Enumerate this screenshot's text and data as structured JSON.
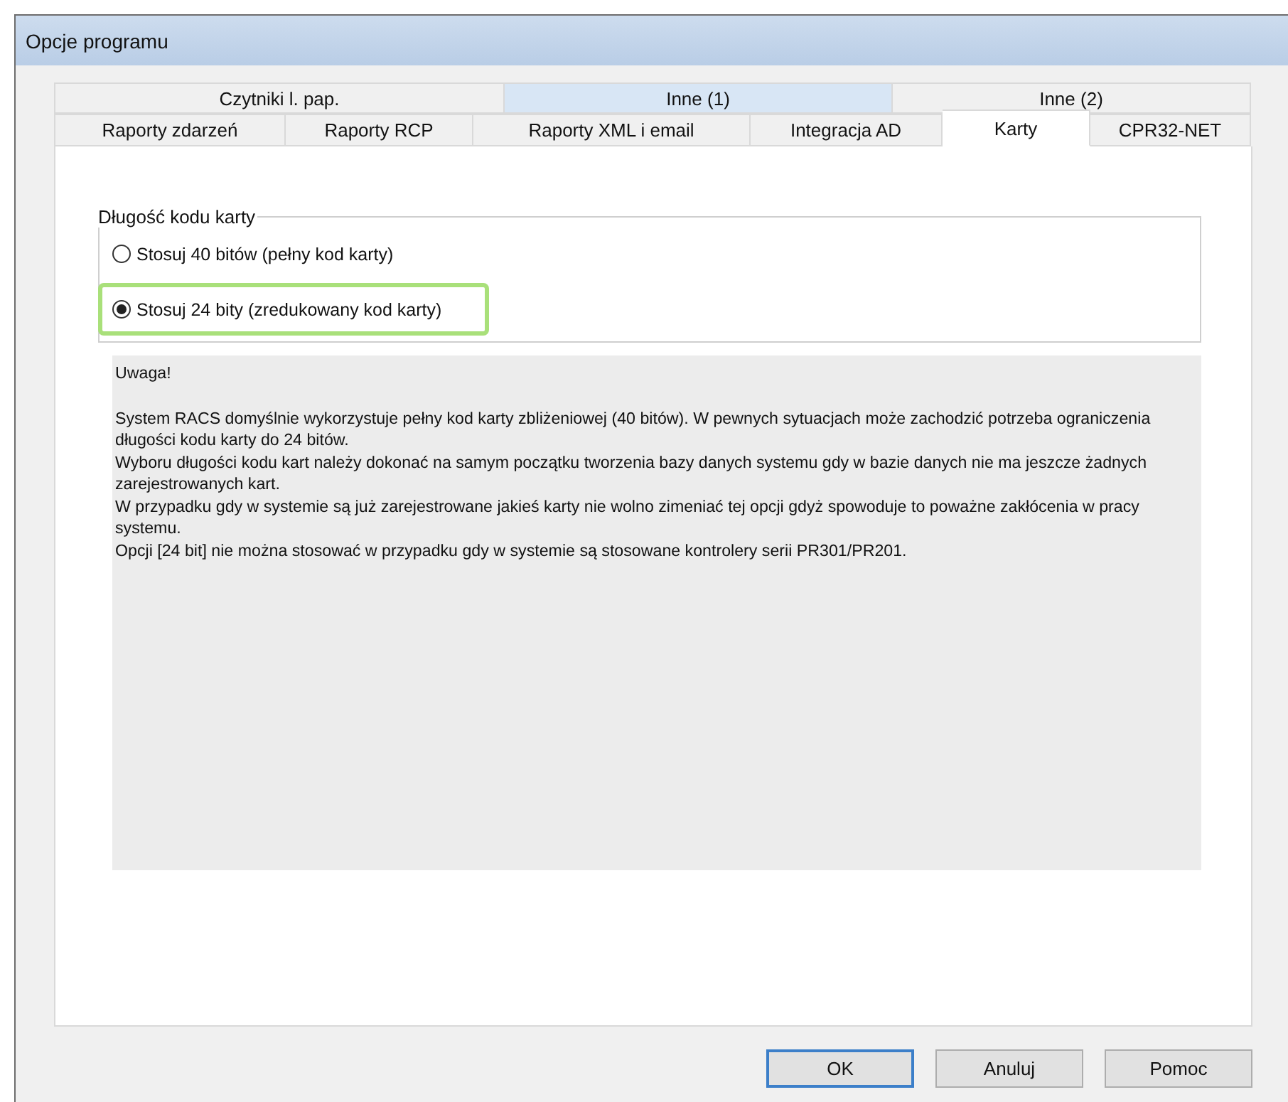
{
  "window": {
    "title": "Opcje programu"
  },
  "tab_rows": [
    [
      {
        "label": "Czytniki l. pap.",
        "selected": false,
        "highlighted": false
      },
      {
        "label": "Inne (1)",
        "selected": false,
        "highlighted": true
      },
      {
        "label": "Inne (2)",
        "selected": false,
        "highlighted": false
      }
    ],
    [
      {
        "label": "Raporty zdarzeń",
        "selected": false,
        "highlighted": false
      },
      {
        "label": "Raporty RCP",
        "selected": false,
        "highlighted": false
      },
      {
        "label": "Raporty XML i email",
        "selected": false,
        "highlighted": false
      },
      {
        "label": "Integracja AD",
        "selected": false,
        "highlighted": false
      },
      {
        "label": "Karty",
        "selected": true,
        "highlighted": false
      },
      {
        "label": "CPR32-NET",
        "selected": false,
        "highlighted": false
      }
    ]
  ],
  "card_length_group": {
    "legend": "Długość kodu karty",
    "options": [
      {
        "label": "Stosuj 40 bitów (pełny kod karty)",
        "selected": false,
        "highlighted": false
      },
      {
        "label": "Stosuj 24 bity (zredukowany kod karty)",
        "selected": true,
        "highlighted": true
      }
    ]
  },
  "note": {
    "heading": "Uwaga!",
    "lines": [
      "System RACS domyślnie wykorzystuje pełny kod karty zbliżeniowej (40 bitów). W pewnych sytuacjach może zachodzić potrzeba ograniczenia długości kodu karty do 24 bitów.",
      "Wyboru długości kodu kart należy dokonać na samym początku tworzenia bazy danych systemu gdy w bazie danych nie ma jeszcze żadnych zarejestrowanych kart.",
      "W przypadku gdy w systemie są już zarejestrowane jakieś karty nie wolno zimeniać tej opcji gdyż spowoduje to poważne zakłócenia w pracy systemu.",
      "Opcji [24 bit] nie można stosować w przypadku gdy w systemie są stosowane kontrolery serii PR301/PR201."
    ]
  },
  "buttons": [
    {
      "label": "OK",
      "default": true
    },
    {
      "label": "Anuluj",
      "default": false
    },
    {
      "label": "Pomoc",
      "default": false
    }
  ]
}
